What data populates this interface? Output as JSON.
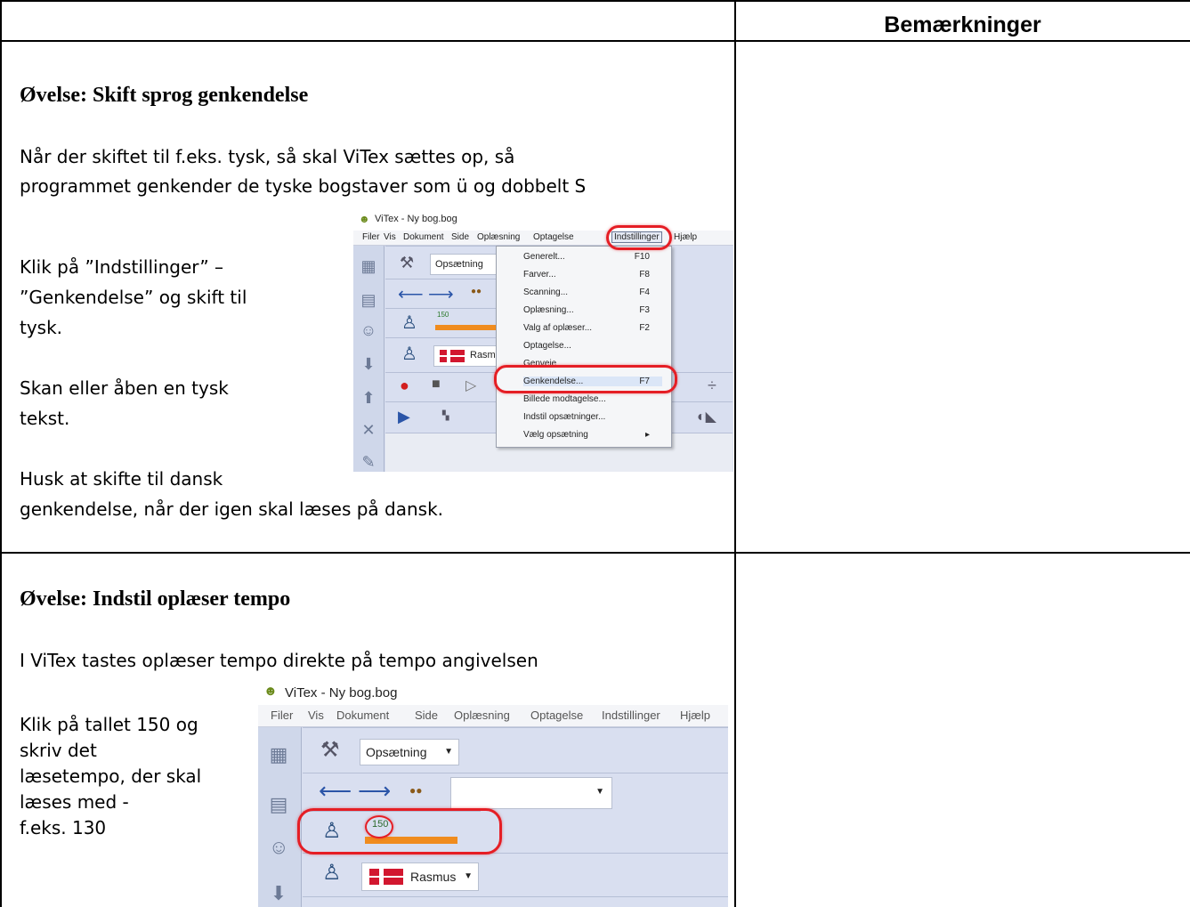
{
  "table": {
    "remarks_header": "Bemærkninger"
  },
  "exercise1": {
    "title": "Øvelse: Skift sprog genkendelse",
    "intro_line1": "Når der skiftet til f.eks. tysk, så skal ViTex sættes op, så",
    "intro_line2": "programmet genkender de tyske bogstaver som ü og dobbelt S",
    "step1_line1": "Klik på ”Indstillinger” –",
    "step1_line2": "”Genkendelse” og skift til",
    "step1_line3": "tysk.",
    "step2_line1": "Skan eller åben en tysk",
    "step2_line2": "tekst.",
    "step3_line1": "Husk at skifte til dansk",
    "step3_line2": "genkendelse, når der igen skal læses på dansk.",
    "screenshot": {
      "window_title": "ViTex - Ny bog.bog",
      "menubar": [
        "Filer",
        "Vis",
        "Dokument",
        "Side",
        "Oplæsning",
        "Optagelse",
        "Indstillinger",
        "Hjælp"
      ],
      "toolbar_setup": "Opsætning",
      "rate": "150",
      "voice": "Rasmus",
      "menu_items": [
        {
          "label": "Generelt...",
          "key": "F10"
        },
        {
          "label": "Farver...",
          "key": "F8"
        },
        {
          "label": "Scanning...",
          "key": "F4"
        },
        {
          "label": "Oplæsning...",
          "key": "F3"
        },
        {
          "label": "Valg af oplæser...",
          "key": "F2"
        },
        {
          "label": "Optagelse...",
          "key": ""
        },
        {
          "label": "Genveje",
          "key": ""
        },
        {
          "label": "Genkendelse...",
          "key": "F7"
        },
        {
          "label": "Billede modtagelse...",
          "key": ""
        },
        {
          "label": "Indstil opsætninger...",
          "key": ""
        },
        {
          "label": "Vælg opsætning",
          "key": "▸"
        }
      ]
    }
  },
  "exercise2": {
    "title": "Øvelse: Indstil oplæser tempo",
    "intro": "I ViTex tastes oplæser tempo direkte på tempo angivelsen",
    "step_line1": "Klik på tallet 150 og",
    "step_line2": "skriv det",
    "step_line3": "læsetempo, der skal",
    "step_line4": "læses med -",
    "step_line5": "f.eks. 130",
    "screenshot": {
      "window_title": "ViTex - Ny bog.bog",
      "menubar": [
        "Filer",
        "Vis",
        "Dokument",
        "Side",
        "Oplæsning",
        "Optagelse",
        "Indstillinger",
        "Hjælp"
      ],
      "toolbar_setup": "Opsætning",
      "rate": "150",
      "voice": "Rasmus"
    }
  },
  "colors": {
    "highlight_ring": "#e51e25",
    "app_bg": "#d9dff0",
    "progress": "#f08c1e"
  },
  "icons": [
    "vitex-logo-icon",
    "wrench-icon",
    "arrow-left-icon",
    "arrow-right-icon",
    "glasses-icon",
    "person-icon",
    "danish-flag-icon",
    "record-icon",
    "stop-icon",
    "play-icon",
    "arrow-down-icon",
    "arrow-up-icon",
    "close-icon",
    "grid-icon",
    "divide-icon",
    "dropdown-arrow-icon"
  ]
}
